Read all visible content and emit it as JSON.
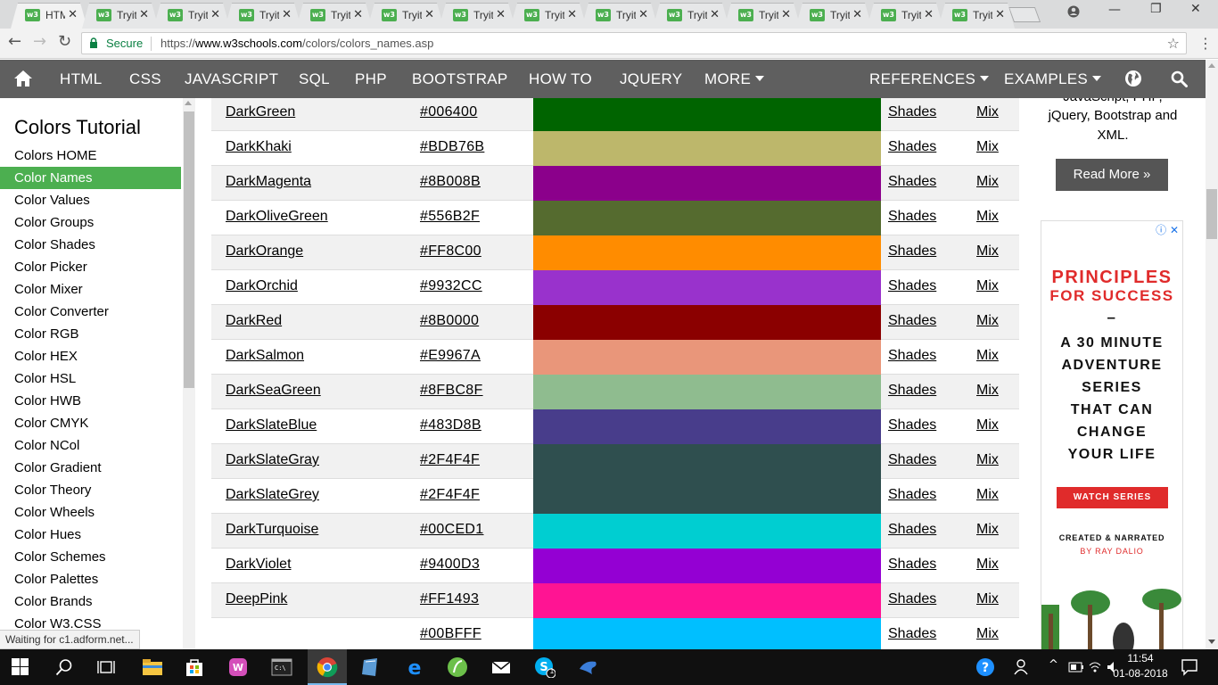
{
  "browser": {
    "tabs": [
      {
        "title": "HTM",
        "active": true
      },
      {
        "title": "Tryit"
      },
      {
        "title": "Tryit"
      },
      {
        "title": "Tryit"
      },
      {
        "title": "Tryit"
      },
      {
        "title": "Tryit"
      },
      {
        "title": "Tryit"
      },
      {
        "title": "Tryit"
      },
      {
        "title": "Tryit"
      },
      {
        "title": "Tryit"
      },
      {
        "title": "Tryit"
      },
      {
        "title": "Tryit"
      },
      {
        "title": "Tryit"
      },
      {
        "title": "Tryit"
      }
    ],
    "tab_favicon": "w3",
    "secure_label": "Secure",
    "url_scheme": "https://",
    "url_host": "www.w3schools.com",
    "url_path": "/colors/colors_names.asp"
  },
  "w3nav": {
    "items": [
      "HTML",
      "CSS",
      "JAVASCRIPT",
      "SQL",
      "PHP",
      "BOOTSTRAP",
      "HOW TO",
      "JQUERY",
      "MORE",
      "REFERENCES",
      "EXAMPLES"
    ]
  },
  "sidebar": {
    "title": "Colors Tutorial",
    "items": [
      "Colors HOME",
      "Color Names",
      "Color Values",
      "Color Groups",
      "Color Shades",
      "Color Picker",
      "Color Mixer",
      "Color Converter",
      "Color RGB",
      "Color HEX",
      "Color HSL",
      "Color HWB",
      "Color CMYK",
      "Color NCol",
      "Color Gradient",
      "Color Theory",
      "Color Wheels",
      "Color Hues",
      "Color Schemes",
      "Color Palettes",
      "Color Brands",
      "Color W3.CSS"
    ],
    "active_index": 1
  },
  "colors": [
    {
      "name": "DarkGreen",
      "hex": "#006400"
    },
    {
      "name": "DarkKhaki",
      "hex": "#BDB76B"
    },
    {
      "name": "DarkMagenta",
      "hex": "#8B008B"
    },
    {
      "name": "DarkOliveGreen",
      "hex": "#556B2F"
    },
    {
      "name": "DarkOrange",
      "hex": "#FF8C00"
    },
    {
      "name": "DarkOrchid",
      "hex": "#9932CC"
    },
    {
      "name": "DarkRed",
      "hex": "#8B0000"
    },
    {
      "name": "DarkSalmon",
      "hex": "#E9967A"
    },
    {
      "name": "DarkSeaGreen",
      "hex": "#8FBC8F"
    },
    {
      "name": "DarkSlateBlue",
      "hex": "#483D8B"
    },
    {
      "name": "DarkSlateGray",
      "hex": "#2F4F4F"
    },
    {
      "name": "DarkSlateGrey",
      "hex": "#2F4F4F"
    },
    {
      "name": "DarkTurquoise",
      "hex": "#00CED1"
    },
    {
      "name": "DarkViolet",
      "hex": "#9400D3"
    },
    {
      "name": "DeepPink",
      "hex": "#FF1493"
    },
    {
      "name": "",
      "hex": "#00BFFF"
    }
  ],
  "row_links": {
    "shades": "Shades",
    "mix": "Mix"
  },
  "right": {
    "text_line1": "JavaScript, PHP,",
    "text_line2": "jQuery, Bootstrap and",
    "text_line3": "XML.",
    "read_more": "Read More »"
  },
  "ad": {
    "headline_red": [
      "PRINCIPLES",
      "FOR SUCCESS"
    ],
    "dash": "–",
    "headline_dark": [
      "A 30 MINUTE",
      "ADVENTURE",
      "SERIES",
      "THAT CAN",
      "CHANGE",
      "YOUR LIFE"
    ],
    "button": "WATCH SERIES",
    "credit1": "CREATED & NARRATED",
    "credit2": "BY RAY DALIO",
    "icons": "ⓘ ✕"
  },
  "status_text": "Waiting for c1.adform.net...",
  "taskbar": {
    "time": "11:54",
    "date": "01-08-2018",
    "skype_badge": "1"
  },
  "theme": {
    "w3_green": "#4caf50",
    "nav_grey": "#5f5f5f",
    "row_alt": "#f1f1f1",
    "ad_red": "#e02b2b"
  }
}
